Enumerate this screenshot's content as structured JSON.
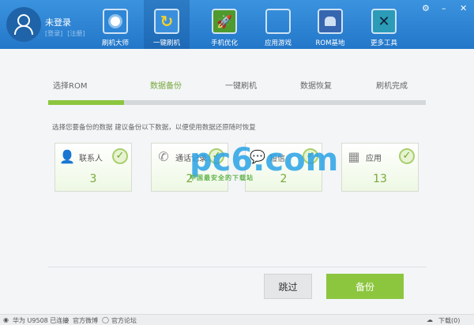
{
  "header": {
    "user_name": "未登录",
    "login": "[登录]",
    "register": "[注册]",
    "nav": [
      {
        "label": "刷机大师",
        "color": "#2e86d6"
      },
      {
        "label": "一键刷机",
        "color": "#3a8fdc"
      },
      {
        "label": "手机优化",
        "color": "#4f9a2e"
      },
      {
        "label": "应用游戏",
        "color": "#e5453f"
      },
      {
        "label": "ROM基地",
        "color": "#3666b0"
      },
      {
        "label": "更多工具",
        "color": "#2b9bb8"
      }
    ],
    "active_nav": 1
  },
  "steps": [
    "选择ROM",
    "数据备份",
    "一键刷机",
    "数据恢复",
    "刷机完成"
  ],
  "current_step": 1,
  "progress_percent": 20,
  "tip": "选择您要备份的数据  建议备份以下数据，以便使用数据还原随时恢复",
  "cards": [
    {
      "label": "联系人",
      "value": "3",
      "icon": "person-icon"
    },
    {
      "label": "通话记录",
      "value": "2",
      "icon": "phone-icon"
    },
    {
      "label": "短信",
      "value": "2",
      "icon": "message-icon"
    },
    {
      "label": "应用",
      "value": "13",
      "icon": "apps-icon"
    }
  ],
  "buttons": {
    "skip": "跳过",
    "backup": "备份"
  },
  "status": {
    "device": "华为 U9508 已连接",
    "weibo": "官方微博",
    "forum": "官方论坛",
    "download": "下载(0)"
  },
  "watermark": {
    "logo": "pc6.com",
    "tagline": "中国最安全的下载站",
    "badge": "下载站"
  }
}
